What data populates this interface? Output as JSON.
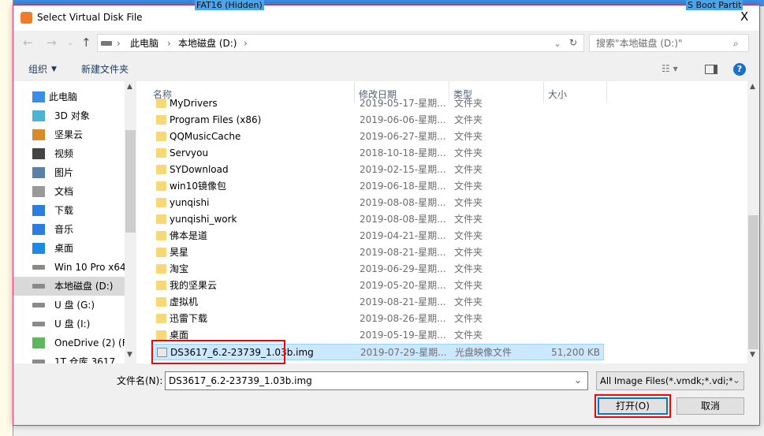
{
  "background": {
    "top_label": "FAT16 (Hidden)",
    "right_label": "S Boot Partit"
  },
  "window": {
    "title": "Select Virtual Disk File",
    "close": "X"
  },
  "nav": {
    "breadcrumb": [
      "此电脑",
      "本地磁盘 (D:)"
    ],
    "search_placeholder": "搜索\"本地磁盘 (D:)\""
  },
  "toolbar": {
    "organize": "组织",
    "new_folder": "新建文件夹"
  },
  "sidebar": {
    "items": [
      {
        "label": "此电脑",
        "icon": "computer-icon"
      },
      {
        "label": "3D 对象",
        "icon": "3d-objects-icon"
      },
      {
        "label": "坚果云",
        "icon": "nutstore-icon"
      },
      {
        "label": "视频",
        "icon": "video-icon"
      },
      {
        "label": "图片",
        "icon": "pictures-icon"
      },
      {
        "label": "文档",
        "icon": "documents-icon"
      },
      {
        "label": "下载",
        "icon": "download-icon"
      },
      {
        "label": "音乐",
        "icon": "music-icon"
      },
      {
        "label": "桌面",
        "icon": "desktop-icon"
      },
      {
        "label": "Win 10 Pro x64",
        "icon": "drive-icon"
      },
      {
        "label": "本地磁盘 (D:)",
        "icon": "drive-icon",
        "selected": true
      },
      {
        "label": "U 盘 (G:)",
        "icon": "drive-icon"
      },
      {
        "label": "U 盘 (I:)",
        "icon": "drive-icon"
      },
      {
        "label": "OneDrive (2) (F",
        "icon": "onedrive-icon"
      },
      {
        "label": "1T 仓库 3617",
        "icon": "drive-icon"
      }
    ]
  },
  "columns": {
    "name": "名称",
    "date": "修改日期",
    "type": "类型",
    "size": "大小"
  },
  "files": [
    {
      "name": "MyDrivers",
      "date": "2019-05-17-星期...",
      "type": "文件夹",
      "size": ""
    },
    {
      "name": "Program Files (x86)",
      "date": "2019-06-06-星期...",
      "type": "文件夹",
      "size": ""
    },
    {
      "name": "QQMusicCache",
      "date": "2019-06-27-星期...",
      "type": "文件夹",
      "size": ""
    },
    {
      "name": "Servyou",
      "date": "2018-10-18-星期...",
      "type": "文件夹",
      "size": ""
    },
    {
      "name": "SYDownload",
      "date": "2019-02-15-星期...",
      "type": "文件夹",
      "size": ""
    },
    {
      "name": "win10镜像包",
      "date": "2019-06-18-星期...",
      "type": "文件夹",
      "size": ""
    },
    {
      "name": "yunqishi",
      "date": "2019-08-08-星期...",
      "type": "文件夹",
      "size": ""
    },
    {
      "name": "yunqishi_work",
      "date": "2019-08-08-星期...",
      "type": "文件夹",
      "size": ""
    },
    {
      "name": "佛本是道",
      "date": "2019-04-21-星期...",
      "type": "文件夹",
      "size": ""
    },
    {
      "name": "昊星",
      "date": "2019-08-21-星期...",
      "type": "文件夹",
      "size": ""
    },
    {
      "name": "淘宝",
      "date": "2019-06-29-星期...",
      "type": "文件夹",
      "size": ""
    },
    {
      "name": "我的坚果云",
      "date": "2019-05-20-星期...",
      "type": "文件夹",
      "size": ""
    },
    {
      "name": "虚拟机",
      "date": "2019-08-21-星期...",
      "type": "文件夹",
      "size": ""
    },
    {
      "name": "迅雷下载",
      "date": "2019-08-26-星期...",
      "type": "文件夹",
      "size": ""
    },
    {
      "name": "桌面",
      "date": "2019-05-19-星期...",
      "type": "文件夹",
      "size": ""
    },
    {
      "name": "DS3617_6.2-23739_1.03b.img",
      "date": "2019-07-29-星期...",
      "type": "光盘映像文件",
      "size": "51,200 KB",
      "selected": true
    }
  ],
  "footer": {
    "filename_label": "文件名(N):",
    "filename_value": "DS3617_6.2-23739_1.03b.img",
    "filter": "All Image Files(*.vmdk;*.vdi;*",
    "open": "打开(O)",
    "cancel": "取消"
  },
  "colors": {
    "highlight": "#ff0000",
    "selection": "#cce8ff",
    "accent": "#0078d7"
  }
}
